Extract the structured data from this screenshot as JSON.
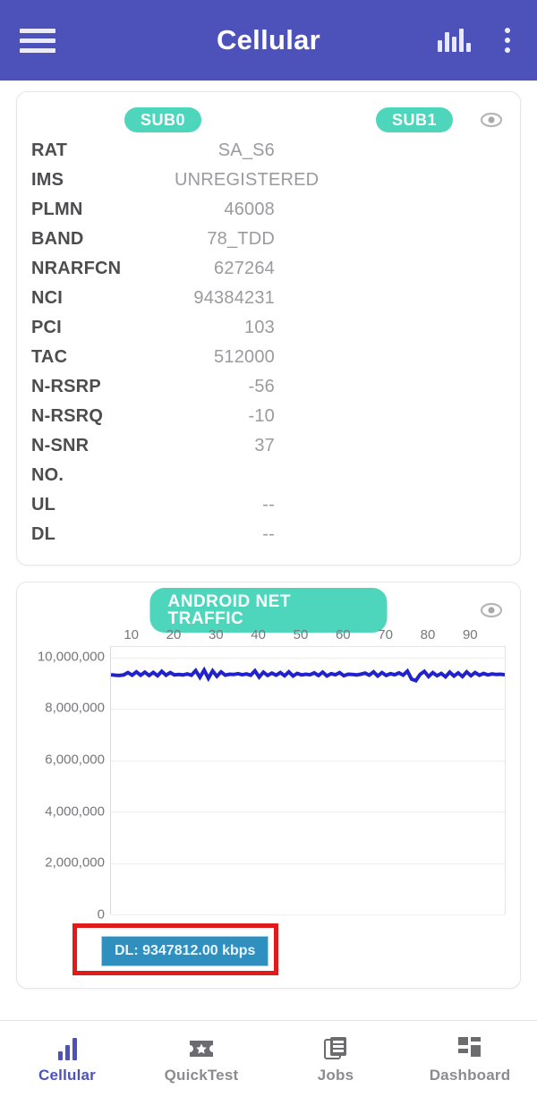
{
  "appbar": {
    "title": "Cellular",
    "menu_icon": "hamburger-menu-icon",
    "chart_icon": "bar-chart-icon",
    "overflow_icon": "kebab-menu-icon"
  },
  "cellular_card": {
    "sub0_label": "SUB0",
    "sub1_label": "SUB1",
    "visibility_icon": "eye-icon",
    "rows": [
      {
        "label": "RAT",
        "value": "SA_S6"
      },
      {
        "label": "IMS",
        "value": "UNREGISTERED"
      },
      {
        "label": "PLMN",
        "value": "46008"
      },
      {
        "label": "BAND",
        "value": "78_TDD"
      },
      {
        "label": "NRARFCN",
        "value": "627264"
      },
      {
        "label": "NCI",
        "value": "94384231"
      },
      {
        "label": "PCI",
        "value": "103"
      },
      {
        "label": "TAC",
        "value": "512000"
      },
      {
        "label": "N-RSRP",
        "value": "-56"
      },
      {
        "label": "N-RSRQ",
        "value": "-10"
      },
      {
        "label": "N-SNR",
        "value": "37"
      },
      {
        "label": "NO.",
        "value": ""
      },
      {
        "label": "UL",
        "value": "--"
      },
      {
        "label": "DL",
        "value": "--"
      }
    ]
  },
  "traffic_card": {
    "title": "ANDROID NET TRAFFIC",
    "visibility_icon": "eye-icon",
    "legend_chip": "DL: 9347812.00 kbps"
  },
  "chart_data": {
    "type": "line",
    "title": "ANDROID NET TRAFFIC",
    "xlabel": "",
    "ylabel": "",
    "x_axis_position": "top",
    "grid": true,
    "legend_position": "bottom-left",
    "xlim": [
      0,
      95
    ],
    "ylim": [
      0,
      10400000
    ],
    "x_ticks": [
      10,
      20,
      30,
      40,
      50,
      60,
      70,
      80,
      90
    ],
    "y_ticks": [
      0,
      2000000,
      4000000,
      6000000,
      8000000,
      10000000
    ],
    "y_tick_labels": [
      "0",
      "2,000,000",
      "4,000,000",
      "6,000,000",
      "8,000,000",
      "10,000,000"
    ],
    "series": [
      {
        "name": "DL",
        "color": "#2222cc",
        "unit": "kbps",
        "current_value": 9347812.0,
        "values": [
          9320000,
          9300000,
          9290000,
          9310000,
          9400000,
          9300000,
          9430000,
          9300000,
          9420000,
          9290000,
          9410000,
          9280000,
          9450000,
          9300000,
          9400000,
          9310000,
          9330000,
          9310000,
          9350000,
          9300000,
          9480000,
          9220000,
          9500000,
          9180000,
          9470000,
          9260000,
          9430000,
          9300000,
          9340000,
          9330000,
          9360000,
          9320000,
          9350000,
          9300000,
          9470000,
          9230000,
          9420000,
          9290000,
          9380000,
          9300000,
          9400000,
          9280000,
          9430000,
          9270000,
          9370000,
          9310000,
          9340000,
          9320000,
          9390000,
          9290000,
          9420000,
          9270000,
          9360000,
          9320000,
          9400000,
          9280000,
          9340000,
          9330000,
          9310000,
          9340000,
          9380000,
          9300000,
          9430000,
          9270000,
          9400000,
          9290000,
          9360000,
          9320000,
          9390000,
          9300000,
          9460000,
          9150000,
          9090000,
          9330000,
          9450000,
          9250000,
          9400000,
          9280000,
          9370000,
          9240000,
          9420000,
          9270000,
          9390000,
          9250000,
          9430000,
          9280000,
          9400000,
          9300000,
          9370000,
          9310000,
          9350000,
          9330000,
          9340000,
          9320000
        ]
      }
    ]
  },
  "bottom_nav": {
    "items": [
      {
        "label": "Cellular",
        "icon": "bar-chart-icon",
        "active": true
      },
      {
        "label": "QuickTest",
        "icon": "ticket-star-icon",
        "active": false
      },
      {
        "label": "Jobs",
        "icon": "documents-icon",
        "active": false
      },
      {
        "label": "Dashboard",
        "icon": "grid-dashboard-icon",
        "active": false
      }
    ]
  }
}
